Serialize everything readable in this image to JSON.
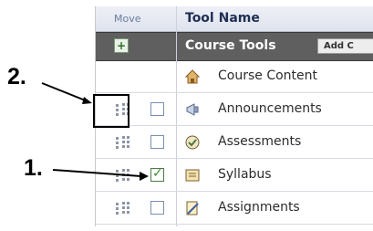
{
  "header": {
    "move_label": "Move",
    "tool_label": "Tool Name"
  },
  "section": {
    "plus_symbol": "+",
    "title": "Course Tools",
    "add_button_label": "Add C"
  },
  "tools": [
    {
      "label": "Course Content",
      "icon": "home-icon",
      "has_controls": false,
      "checked": false
    },
    {
      "label": "Announcements",
      "icon": "megaphone-icon",
      "has_controls": true,
      "checked": false
    },
    {
      "label": "Assessments",
      "icon": "assessment-icon",
      "has_controls": true,
      "checked": false
    },
    {
      "label": "Syllabus",
      "icon": "syllabus-icon",
      "has_controls": true,
      "checked": true
    },
    {
      "label": "Assignments",
      "icon": "assignment-icon",
      "has_controls": true,
      "checked": false
    }
  ],
  "annotations": {
    "label_2": "2.",
    "label_1": "1."
  },
  "colors": {
    "header_band": "#5f5f5f",
    "check_green": "#3c8d2f",
    "link_blue": "#7b8fb4"
  }
}
